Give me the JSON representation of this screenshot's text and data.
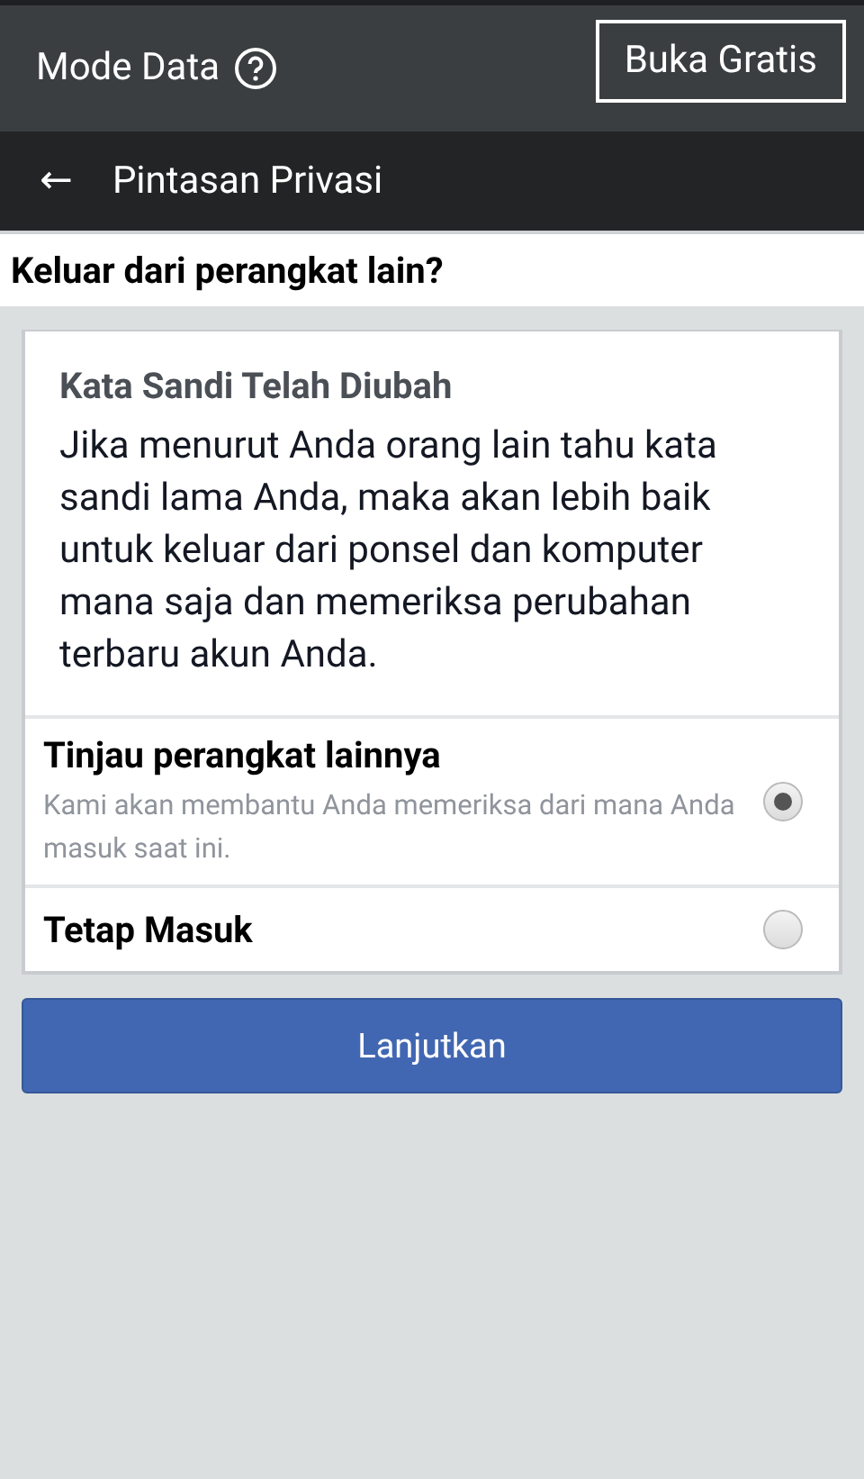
{
  "data_bar": {
    "title": "Mode Data",
    "button": "Buka Gratis"
  },
  "nav_bar": {
    "back": "←",
    "title": "Pintasan Privasi"
  },
  "heading": "Keluar dari perangkat lain?",
  "card": {
    "title": "Kata Sandi Telah Diubah",
    "body": "Jika menurut Anda orang lain tahu kata sandi lama Anda, maka akan lebih baik untuk keluar dari ponsel dan komputer mana saja dan memeriksa perubahan terbaru akun Anda."
  },
  "options": [
    {
      "label": "Tinjau perangkat lainnya",
      "description": "Kami akan membantu Anda memeriksa dari mana Anda masuk saat ini.",
      "selected": true
    },
    {
      "label": "Tetap Masuk",
      "selected": false
    }
  ],
  "continue_button": "Lanjutkan"
}
